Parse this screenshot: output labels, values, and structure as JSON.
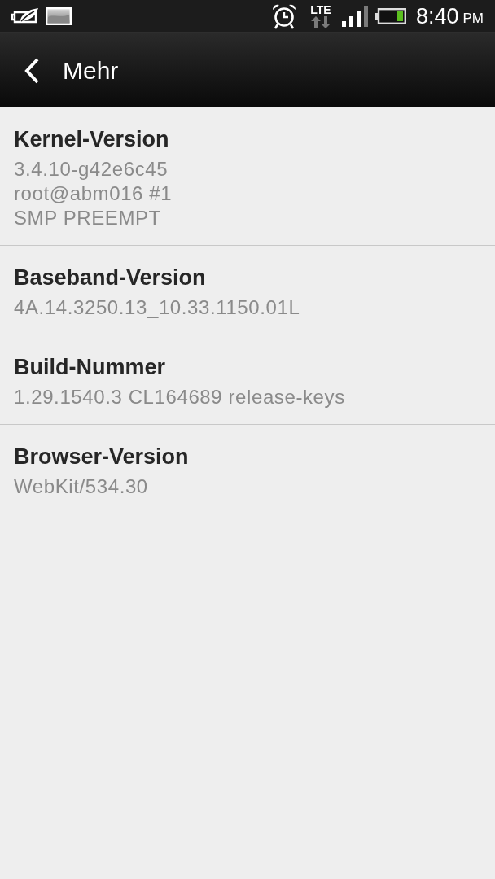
{
  "status_bar": {
    "network": "LTE",
    "time": "8:40",
    "meridiem": "PM"
  },
  "header": {
    "title": "Mehr"
  },
  "settings": [
    {
      "title": "Kernel-Version",
      "value_lines": [
        "3.4.10-g42e6c45",
        "root@abm016 #1",
        "SMP PREEMPT"
      ]
    },
    {
      "title": "Baseband-Version",
      "value_lines": [
        "4A.14.3250.13_10.33.1150.01L"
      ]
    },
    {
      "title": "Build-Nummer",
      "value_lines": [
        "1.29.1540.3 CL164689 release-keys"
      ]
    },
    {
      "title": "Browser-Version",
      "value_lines": [
        "WebKit/534.30"
      ]
    }
  ]
}
